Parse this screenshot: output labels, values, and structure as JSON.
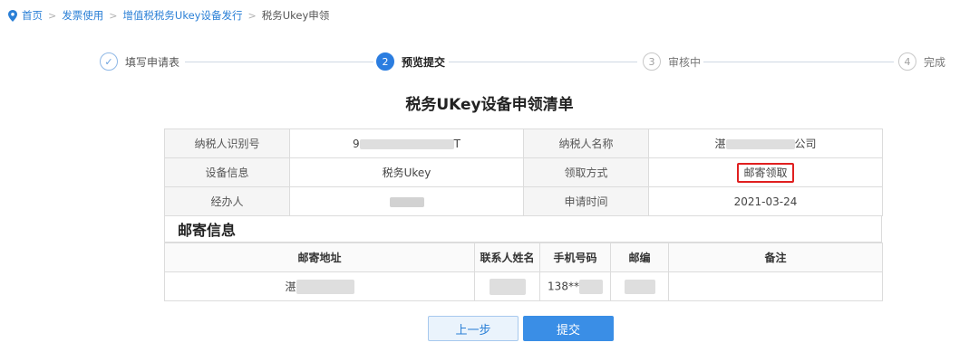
{
  "breadcrumb": {
    "home": "首页",
    "invoice_use": "发票使用",
    "ukey_issue": "增值税税务Ukey设备发行",
    "current": "税务Ukey申领",
    "separator": ">"
  },
  "steps": [
    {
      "num": "✓",
      "label": "填写申请表",
      "state": "done"
    },
    {
      "num": "2",
      "label": "预览提交",
      "state": "active"
    },
    {
      "num": "3",
      "label": "审核中",
      "state": "todo"
    },
    {
      "num": "4",
      "label": "完成",
      "state": "todo"
    }
  ],
  "title": "税务UKey设备申领清单",
  "info": {
    "taxpayer_id_label": "纳税人识别号",
    "taxpayer_id_prefix": "9",
    "taxpayer_id_suffix": "T",
    "taxpayer_name_label": "纳税人名称",
    "taxpayer_name_prefix": "湛",
    "taxpayer_name_suffix": "公司",
    "device_info_label": "设备信息",
    "device_info_value": "税务Ukey",
    "pickup_method_label": "领取方式",
    "pickup_method_value": "邮寄领取",
    "handler_label": "经办人",
    "apply_time_label": "申请时间",
    "apply_time_value": "2021-03-24"
  },
  "mail": {
    "section_title": "邮寄信息",
    "headers": [
      "邮寄地址",
      "联系人姓名",
      "手机号码",
      "邮编",
      "备注"
    ],
    "address_prefix": "湛",
    "phone_prefix": "138**"
  },
  "buttons": {
    "prev": "上一步",
    "submit": "提交"
  },
  "colors": {
    "accent": "#2b7de0",
    "highlight_box": "#e02020"
  }
}
